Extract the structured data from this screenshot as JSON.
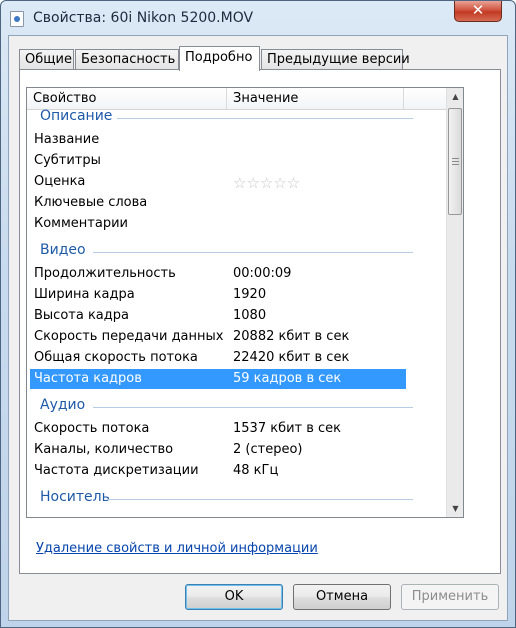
{
  "window": {
    "title": "Свойства: 60i Nikon 5200.MOV",
    "close_glyph": "✕"
  },
  "tabs": [
    {
      "label": "Общие",
      "active": false
    },
    {
      "label": "Безопасность",
      "active": false
    },
    {
      "label": "Подробно",
      "active": true
    },
    {
      "label": "Предыдущие версии",
      "active": false
    }
  ],
  "list": {
    "headers": {
      "property": "Свойство",
      "value": "Значение"
    },
    "groups": {
      "description": {
        "label": "Описание",
        "rows": [
          {
            "property": "Название",
            "value": ""
          },
          {
            "property": "Субтитры",
            "value": ""
          },
          {
            "property": "Оценка",
            "value": ""
          },
          {
            "property": "Ключевые слова",
            "value": ""
          },
          {
            "property": "Комментарии",
            "value": ""
          }
        ],
        "rating_stars": "☆☆☆☆☆",
        "rating_value": 0
      },
      "video": {
        "label": "Видео",
        "rows": [
          {
            "property": "Продолжительность",
            "value": "00:00:09"
          },
          {
            "property": "Ширина кадра",
            "value": "1920"
          },
          {
            "property": "Высота кадра",
            "value": "1080"
          },
          {
            "property": "Скорость передачи данных",
            "value": "20882 кбит в сек"
          },
          {
            "property": "Общая скорость потока",
            "value": "22420 кбит в сек"
          },
          {
            "property": "Частота кадров",
            "value": "59 кадров в сек",
            "selected": true
          }
        ]
      },
      "audio": {
        "label": "Аудио",
        "rows": [
          {
            "property": "Скорость потока",
            "value": "1537 кбит в сек"
          },
          {
            "property": "Каналы, количество",
            "value": "2 (стерео)"
          },
          {
            "property": "Частота дискретизации",
            "value": "48 кГц"
          }
        ]
      },
      "media": {
        "label": "Носитель"
      }
    },
    "scrollbar": {
      "up_glyph": "▲",
      "down_glyph": "▼"
    }
  },
  "remove_link": "Удаление свойств и личной информации",
  "buttons": {
    "ok": "OK",
    "cancel": "Отмена",
    "apply": "Применить"
  },
  "colors": {
    "selection": "#3399ff",
    "group_header": "#1e5aa8",
    "link": "#0645ad"
  }
}
